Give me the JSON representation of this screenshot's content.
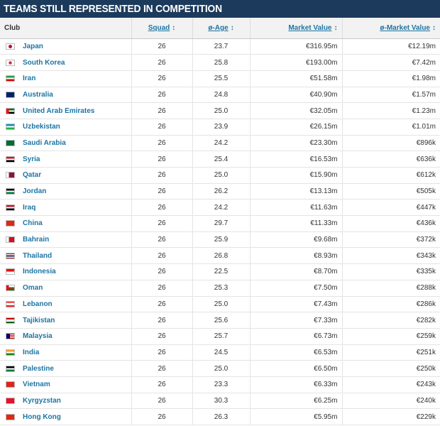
{
  "title": "TEAMS STILL REPRESENTED IN COMPETITION",
  "headers": {
    "club": "Club",
    "squad": "Squad",
    "age": "ø-Age",
    "market_value": "Market Value",
    "avg_market_value": "ø-Market Value",
    "sort_glyph": "↕"
  },
  "rows": [
    {
      "club": "Japan",
      "squad": "26",
      "age": "23.7",
      "mv": "€316.95m",
      "amv": "€12.19m",
      "flag": "linear-gradient(#fff,#fff)",
      "flag_icon": "flag-japan-icon"
    },
    {
      "club": "South Korea",
      "squad": "26",
      "age": "25.8",
      "mv": "€193.00m",
      "amv": "€7.42m",
      "flag": "linear-gradient(#fff,#fff)",
      "flag_icon": "flag-south-korea-icon"
    },
    {
      "club": "Iran",
      "squad": "26",
      "age": "25.5",
      "mv": "€51.58m",
      "amv": "€1.98m",
      "flag": "linear-gradient(#239f40 33%,#fff 33% 66%,#da0000 66%)",
      "flag_icon": "flag-iran-icon"
    },
    {
      "club": "Australia",
      "squad": "26",
      "age": "24.8",
      "mv": "€40.90m",
      "amv": "€1.57m",
      "flag": "linear-gradient(#012169,#012169)",
      "flag_icon": "flag-australia-icon"
    },
    {
      "club": "United Arab Emirates",
      "squad": "26",
      "age": "25.0",
      "mv": "€32.05m",
      "amv": "€1.23m",
      "flag": "linear-gradient(90deg,#ff0000 30%,transparent 30%),linear-gradient(#00732f 33%,#fff 33% 66%,#000 66%)",
      "flag_icon": "flag-uae-icon"
    },
    {
      "club": "Uzbekistan",
      "squad": "26",
      "age": "23.9",
      "mv": "€26.15m",
      "amv": "€1.01m",
      "flag": "linear-gradient(#0099b5 33%,#fff 33% 66%,#1eb53a 66%)",
      "flag_icon": "flag-uzbekistan-icon"
    },
    {
      "club": "Saudi Arabia",
      "squad": "26",
      "age": "24.2",
      "mv": "€23.30m",
      "amv": "€896k",
      "flag": "linear-gradient(#006c35,#006c35)",
      "flag_icon": "flag-saudi-arabia-icon"
    },
    {
      "club": "Syria",
      "squad": "26",
      "age": "25.4",
      "mv": "€16.53m",
      "amv": "€636k",
      "flag": "linear-gradient(#ce1126 33%,#fff 33% 66%,#000 66%)",
      "flag_icon": "flag-syria-icon"
    },
    {
      "club": "Qatar",
      "squad": "26",
      "age": "25.0",
      "mv": "€15.90m",
      "amv": "€612k",
      "flag": "linear-gradient(90deg,#fff 30%,#8a1538 30%)",
      "flag_icon": "flag-qatar-icon"
    },
    {
      "club": "Jordan",
      "squad": "26",
      "age": "26.2",
      "mv": "€13.13m",
      "amv": "€505k",
      "flag": "linear-gradient(#000 33%,#fff 33% 66%,#007a3d 66%)",
      "flag_icon": "flag-jordan-icon"
    },
    {
      "club": "Iraq",
      "squad": "26",
      "age": "24.2",
      "mv": "€11.63m",
      "amv": "€447k",
      "flag": "linear-gradient(#ce1126 33%,#fff 33% 66%,#000 66%)",
      "flag_icon": "flag-iraq-icon"
    },
    {
      "club": "China",
      "squad": "26",
      "age": "29.7",
      "mv": "€11.33m",
      "amv": "€436k",
      "flag": "linear-gradient(#de2910,#de2910)",
      "flag_icon": "flag-china-icon"
    },
    {
      "club": "Bahrain",
      "squad": "26",
      "age": "25.9",
      "mv": "€9.68m",
      "amv": "€372k",
      "flag": "linear-gradient(90deg,#fff 30%,#ce1126 30%)",
      "flag_icon": "flag-bahrain-icon"
    },
    {
      "club": "Thailand",
      "squad": "26",
      "age": "26.8",
      "mv": "€8.93m",
      "amv": "€343k",
      "flag": "linear-gradient(#a51931 17%,#f4f5f8 17% 33%,#2d2a4a 33% 67%,#f4f5f8 67% 83%,#a51931 83%)",
      "flag_icon": "flag-thailand-icon"
    },
    {
      "club": "Indonesia",
      "squad": "26",
      "age": "22.5",
      "mv": "€8.70m",
      "amv": "€335k",
      "flag": "linear-gradient(#ff0000 50%,#fff 50%)",
      "flag_icon": "flag-indonesia-icon"
    },
    {
      "club": "Oman",
      "squad": "26",
      "age": "25.3",
      "mv": "€7.50m",
      "amv": "€288k",
      "flag": "linear-gradient(90deg,#db161b 30%,transparent 30%),linear-gradient(#fff 33%,#db161b 33% 66%,#008000 66%)",
      "flag_icon": "flag-oman-icon"
    },
    {
      "club": "Lebanon",
      "squad": "26",
      "age": "25.0",
      "mv": "€7.43m",
      "amv": "€286k",
      "flag": "linear-gradient(#ee161f 25%,#fff 25% 75%,#ee161f 75%)",
      "flag_icon": "flag-lebanon-icon"
    },
    {
      "club": "Tajikistan",
      "squad": "26",
      "age": "25.6",
      "mv": "€7.33m",
      "amv": "€282k",
      "flag": "linear-gradient(#cc0000 28%,#fff 28% 72%,#006600 72%)",
      "flag_icon": "flag-tajikistan-icon"
    },
    {
      "club": "Malaysia",
      "squad": "26",
      "age": "25.7",
      "mv": "€6.73m",
      "amv": "€259k",
      "flag": "linear-gradient(90deg,#010066 45%,transparent 45%),repeating-linear-gradient(#cc0001 0 1px,#fff 1px 2px)",
      "flag_icon": "flag-malaysia-icon"
    },
    {
      "club": "India",
      "squad": "26",
      "age": "24.5",
      "mv": "€6.53m",
      "amv": "€251k",
      "flag": "linear-gradient(#ff9933 33%,#fff 33% 66%,#138808 66%)",
      "flag_icon": "flag-india-icon"
    },
    {
      "club": "Palestine",
      "squad": "26",
      "age": "25.0",
      "mv": "€6.50m",
      "amv": "€250k",
      "flag": "linear-gradient(#000 33%,#fff 33% 66%,#007a3d 66%)",
      "flag_icon": "flag-palestine-icon"
    },
    {
      "club": "Vietnam",
      "squad": "26",
      "age": "23.3",
      "mv": "€6.33m",
      "amv": "€243k",
      "flag": "linear-gradient(#da251d,#da251d)",
      "flag_icon": "flag-vietnam-icon"
    },
    {
      "club": "Kyrgyzstan",
      "squad": "26",
      "age": "30.3",
      "mv": "€6.25m",
      "amv": "€240k",
      "flag": "linear-gradient(#e8112d,#e8112d)",
      "flag_icon": "flag-kyrgyzstan-icon"
    },
    {
      "club": "Hong Kong",
      "squad": "26",
      "age": "26.3",
      "mv": "€5.95m",
      "amv": "€229k",
      "flag": "linear-gradient(#de2910,#de2910)",
      "flag_icon": "flag-hong-kong-icon"
    }
  ]
}
